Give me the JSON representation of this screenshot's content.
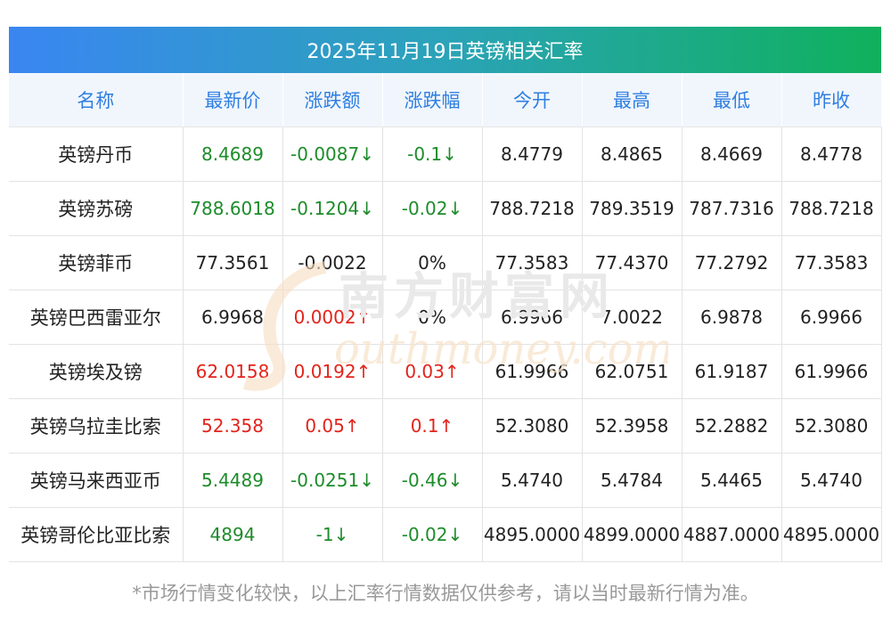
{
  "title": "2025年11月19日英镑相关汇率",
  "headers": [
    "名称",
    "最新价",
    "涨跌额",
    "涨跌幅",
    "今开",
    "最高",
    "最低",
    "昨收"
  ],
  "rows": [
    {
      "name": "英镑丹币",
      "latest": "8.4689",
      "change": "-0.0087↓",
      "pct": "-0.1↓",
      "open": "8.4779",
      "high": "8.4865",
      "low": "8.4669",
      "prev": "8.4778",
      "trend": "down"
    },
    {
      "name": "英镑苏磅",
      "latest": "788.6018",
      "change": "-0.1204↓",
      "pct": "-0.02↓",
      "open": "788.7218",
      "high": "789.3519",
      "low": "787.7316",
      "prev": "788.7218",
      "trend": "down"
    },
    {
      "name": "英镑菲币",
      "latest": "77.3561",
      "change": "-0.0022",
      "pct": "0%",
      "open": "77.3583",
      "high": "77.4370",
      "low": "77.2792",
      "prev": "77.3583",
      "trend": "flat"
    },
    {
      "name": "英镑巴西雷亚尔",
      "latest": "6.9968",
      "change": "0.0002↑",
      "pct": "0%",
      "open": "6.9966",
      "high": "7.0022",
      "low": "6.9878",
      "prev": "6.9966",
      "trend": "up-flat"
    },
    {
      "name": "英镑埃及镑",
      "latest": "62.0158",
      "change": "0.0192↑",
      "pct": "0.03↑",
      "open": "61.9966",
      "high": "62.0751",
      "low": "61.9187",
      "prev": "61.9966",
      "trend": "up"
    },
    {
      "name": "英镑乌拉圭比索",
      "latest": "52.358",
      "change": "0.05↑",
      "pct": "0.1↑",
      "open": "52.3080",
      "high": "52.3958",
      "low": "52.2882",
      "prev": "52.3080",
      "trend": "up"
    },
    {
      "name": "英镑马来西亚币",
      "latest": "5.4489",
      "change": "-0.0251↓",
      "pct": "-0.46↓",
      "open": "5.4740",
      "high": "5.4784",
      "low": "5.4465",
      "prev": "5.4740",
      "trend": "down"
    },
    {
      "name": "英镑哥伦比亚比索",
      "latest": "4894",
      "change": "-1↓",
      "pct": "-0.02↓",
      "open": "4895.0000",
      "high": "4899.0000",
      "low": "4887.0000",
      "prev": "4895.0000",
      "trend": "down"
    }
  ],
  "footnote": "*市场行情变化较快，以上汇率行情数据仅供参考，请以当时最新行情为准。",
  "watermark": {
    "cn": "南方财富网",
    "en": "outhmoney.com"
  },
  "colors": {
    "header_text": "#2f7fe0",
    "up": "#e2241c",
    "down": "#1e8c2b",
    "header_bg": "#f1f6fd"
  }
}
